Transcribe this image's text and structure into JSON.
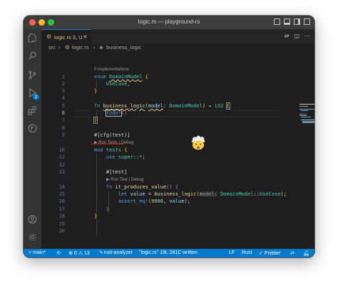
{
  "window": {
    "title": "logic.rs — playground-rs"
  },
  "activity_bar": {
    "items": [
      {
        "name": "explorer"
      },
      {
        "name": "search"
      },
      {
        "name": "source-control",
        "badge": "2"
      },
      {
        "name": "run-debug"
      },
      {
        "name": "extensions"
      },
      {
        "name": "git-graph"
      }
    ],
    "bottom": [
      {
        "name": "accounts"
      },
      {
        "name": "manage"
      }
    ]
  },
  "tab": {
    "label": "logic.rs 3, U",
    "close": "×"
  },
  "breadcrumbs": {
    "items": [
      "src",
      "logic.rs",
      "business_logic"
    ],
    "separator": "›"
  },
  "code": {
    "line_numbers": [
      "1",
      "2",
      "3",
      "4",
      "5",
      "6",
      "7",
      "8",
      "9",
      "10",
      "11",
      "12",
      "13",
      "14",
      "15",
      "16",
      "17",
      "18",
      "19",
      "20"
    ],
    "current_line": "6",
    "lens": {
      "implementations": "0 implementations",
      "run_tests": "▶ Run Tests | Debug",
      "run_test": "▶ Run Test | Debug"
    },
    "tokens": {
      "enum": "enum",
      "DomainModel": "DomainModel",
      "open_brace": "{",
      "close_brace": "}",
      "UseCase": "UseCase",
      "comma": ",",
      "fn": "fn",
      "business_logic": "business_logic",
      "open_paren": "(",
      "close_paren": ")",
      "model": "model",
      "colon": ":",
      "arrow": "→",
      "i32": "i32",
      "todo": "todo!",
      "parens": "()",
      "attr_cfg": "#[cfg(test)]",
      "mod": "mod",
      "tests": "tests",
      "use": "use",
      "super_all": "super::*",
      "semicolon": ";",
      "attr_test": "#[test]",
      "it_produces_value": "it_produces_value",
      "empty_parens": "()",
      "let": "let",
      "value": "value",
      "eq": "=",
      "hint_model": "model:",
      "path_sep": "::",
      "assert_eq": "assert_eq!",
      "num_9000": "9000",
      "value_arg": "value",
      "paren_semi": ");"
    }
  },
  "status_bar": {
    "branch": "main*",
    "errors": "0",
    "warnings": "13",
    "rust_analyzer": "rust-analyzer",
    "file_status": "\"logic.rs\" 19L 281C written",
    "eol": "LF",
    "language": "Rust",
    "prettier": "Prettier",
    "accent_color": "#007acc"
  },
  "colors": {
    "keyword": "#569cd6",
    "type": "#4ec9b0",
    "function": "#dcdcaa",
    "param": "#9cdcfe",
    "tab_modified": "#e2c08d"
  }
}
